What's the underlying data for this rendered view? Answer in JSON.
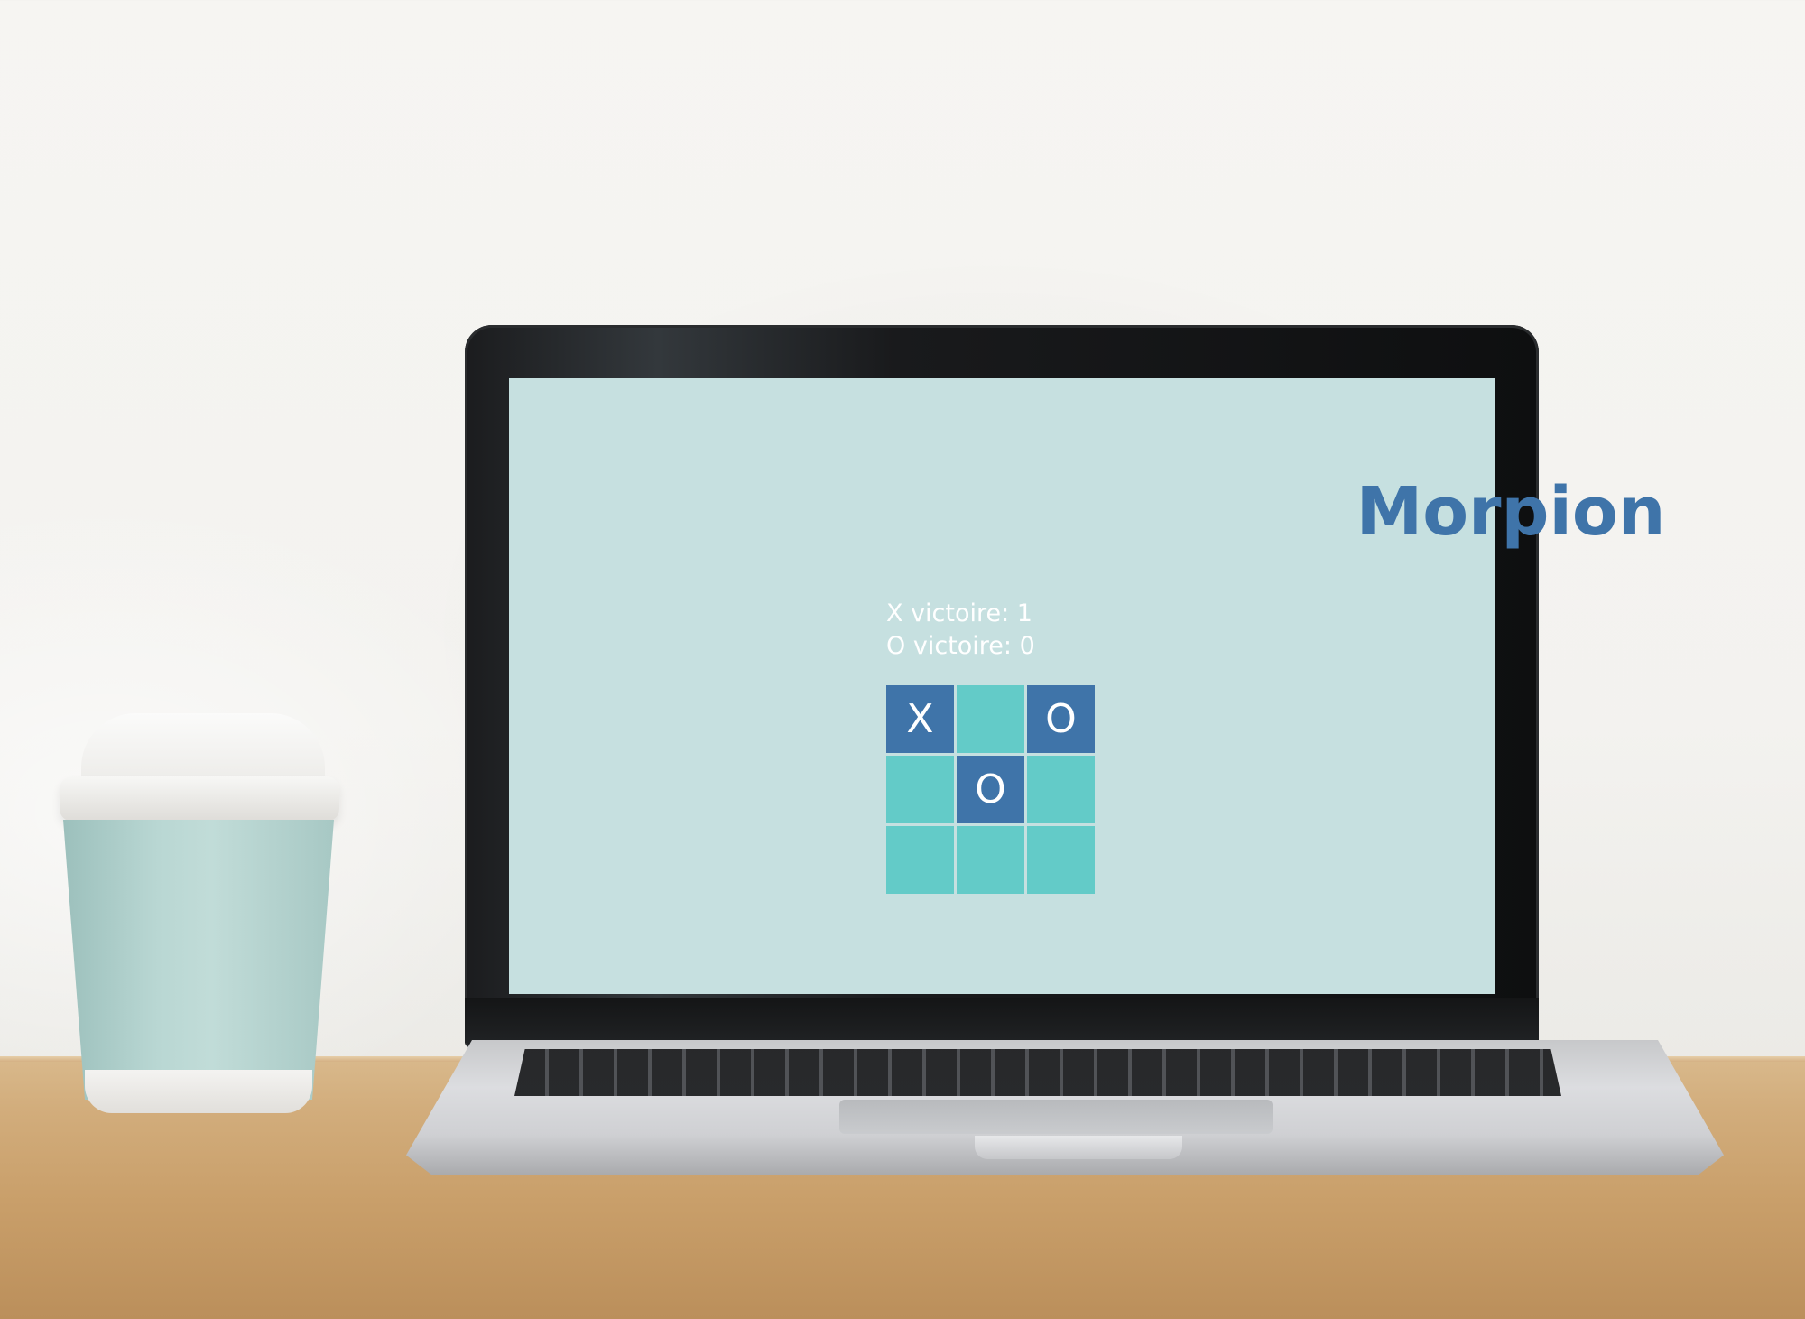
{
  "game": {
    "title": "Morpion",
    "scores": {
      "x_line": "X victoire: 1",
      "o_line": "O victoire: 0"
    },
    "board": [
      [
        "X",
        "",
        "O"
      ],
      [
        "",
        "O",
        ""
      ],
      [
        "",
        "",
        ""
      ]
    ]
  },
  "colors": {
    "screen_background": "#c6e0e0",
    "title": "#3f74a9",
    "cell_empty": "#63cbc8",
    "cell_filled": "#3f74a9",
    "text_light": "#ffffff"
  }
}
